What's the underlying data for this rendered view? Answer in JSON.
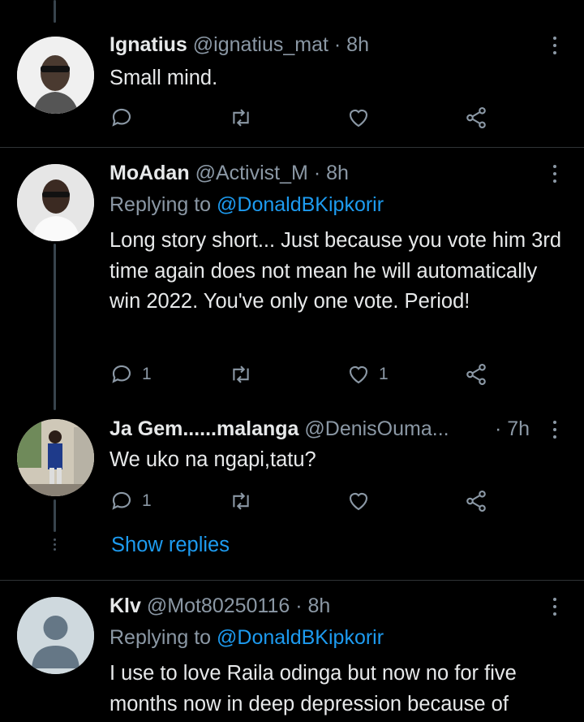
{
  "tweets": [
    {
      "name": "Ignatius",
      "handle": "@ignatius_mat",
      "time": "· 8h",
      "replying_prefix": "",
      "replying_to": "",
      "text": "Small mind.",
      "replies": "",
      "retweets": "",
      "likes": ""
    },
    {
      "name": "MoAdan",
      "handle": "@Activist_M",
      "time": "· 8h",
      "replying_prefix": "Replying to ",
      "replying_to": "@DonaldBKipkorir",
      "text": "Long story short... Just because you vote him 3rd time again does not mean he will automatically win 2022. You've only one vote. Period!",
      "replies": "1",
      "retweets": "",
      "likes": "1"
    },
    {
      "name": "Ja Gem......malanga",
      "handle": "@DenisOuma...",
      "time": "· 7h",
      "replying_prefix": "",
      "replying_to": "",
      "text": "We uko na ngapi,tatu?",
      "replies": "1",
      "retweets": "",
      "likes": ""
    },
    {
      "name": "Klv",
      "handle": "@Mot80250116",
      "time": "· 8h",
      "replying_prefix": "Replying to ",
      "replying_to": "@DonaldBKipkorir",
      "text": "I use to love Raila odinga but now no for five months now in deep depression because of",
      "replies": "",
      "retweets": "",
      "likes": ""
    }
  ],
  "show_replies_label": "Show replies",
  "icons": {
    "reply": "reply-icon",
    "retweet": "retweet-icon",
    "like": "heart-icon",
    "share": "share-icon",
    "more": "more-options-icon"
  },
  "colors": {
    "background": "#000000",
    "text": "#e7e9ea",
    "muted": "#8b98a5",
    "accent": "#1d9bf0",
    "divider": "#2f3336"
  }
}
